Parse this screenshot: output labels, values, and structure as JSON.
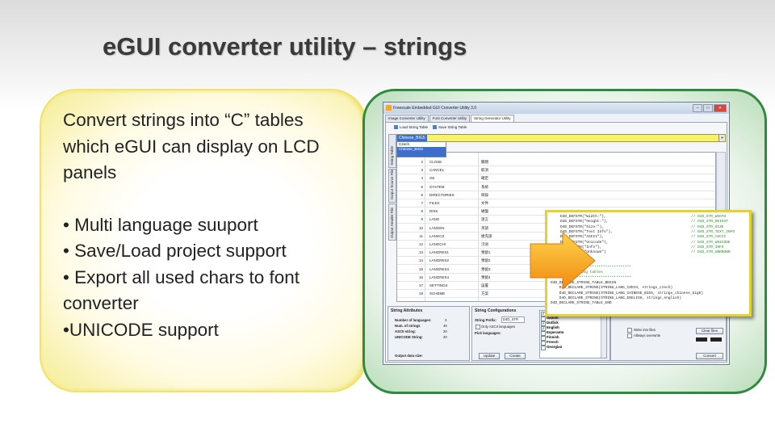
{
  "slide": {
    "title": "eGUI converter utility – strings",
    "intro": "Convert strings into “C” tables which eGUI can display on LCD panels",
    "bullets": [
      "• Multi language suuport",
      "• Save/Load project support",
      "• Export all used chars to font",
      "converter",
      "•UNICODE support"
    ]
  },
  "app": {
    "window_title": "Freescale Embedded GUI Converter Utility 3.0",
    "tabs": [
      "Image Converter Utility",
      "Font Converter Utility",
      "String Generator Utility"
    ],
    "toolbar": {
      "load": "Load String Table",
      "save": "Save String Table"
    },
    "vertical_tabs": [
      "String Table",
      "Output Source File",
      "Output Header File"
    ],
    "language_combo": "Chinese_BIG5",
    "language_dropdown": [
      "Czech",
      "Chinese_BIG5",
      ""
    ],
    "rows": [
      {
        "idx": "2",
        "name": "CLOSE",
        "val": "關閉"
      },
      {
        "idx": "3",
        "name": "CANCEL",
        "val": "取消"
      },
      {
        "idx": "4",
        "name": "OK",
        "val": "確定"
      },
      {
        "idx": "5",
        "name": "SYSTEM",
        "val": "系統"
      },
      {
        "idx": "6",
        "name": "DIRECTORIES",
        "val": "目錄"
      },
      {
        "idx": "7",
        "name": "FILES",
        "val": "文件"
      },
      {
        "idx": "8",
        "name": "DISK",
        "val": "磁盤"
      },
      {
        "idx": "9",
        "name": "LANG",
        "val": "語言"
      },
      {
        "idx": "10",
        "name": "LANGEN",
        "val": "英語"
      },
      {
        "idx": "11",
        "name": "LANGCZ",
        "val": "捷克語"
      },
      {
        "idx": "12",
        "name": "LANGCHI",
        "val": "汉语"
      },
      {
        "idx": "13",
        "name": "LANGRES1",
        "val": "預留1"
      },
      {
        "idx": "14",
        "name": "LANGRES2",
        "val": "預留2"
      },
      {
        "idx": "15",
        "name": "LANGRES3",
        "val": "預留3"
      },
      {
        "idx": "16",
        "name": "LANGRES4",
        "val": "預留4"
      },
      {
        "idx": "17",
        "name": "SETTINGS",
        "val": "設置"
      },
      {
        "idx": "18",
        "name": "SCHEME",
        "val": "方案"
      }
    ],
    "string_attributes": {
      "title": "String Attributes",
      "num_languages_label": "Number of languages:",
      "num_languages": "3",
      "num_strings_label": "Num. of strings",
      "num_strings": "40",
      "ascii_label": "ASCII string:",
      "ascii": "20",
      "unicode_label": "UNICODE String:",
      "unicode": "20",
      "output_size_label": "Output data size:"
    },
    "string_config": {
      "title": "String Configurations",
      "prefix_label": "String Prefix:",
      "prefix": "D4D_STR",
      "only_ascii": "Only ASCII languages",
      "pick_label": "Pick languages:",
      "update": "Update",
      "create": "Create"
    },
    "languages": [
      {
        "name": "Chinese_BIG5",
        "checked": true
      },
      {
        "name": "Danish",
        "checked": false
      },
      {
        "name": "Dutlick",
        "checked": true
      },
      {
        "name": "English",
        "checked": true
      },
      {
        "name": "Esperanto",
        "checked": false
      },
      {
        "name": "Finnish",
        "checked": false
      },
      {
        "name": "French",
        "checked": false
      },
      {
        "name": "Georgian",
        "checked": false
      }
    ],
    "right_group": {
      "write_files": "Write into files",
      "overwrite": "Allways overwrite",
      "clear_files": "Clear files",
      "convert": "Convert"
    }
  },
  "code": {
    "lines": [
      {
        "text": "D4D_DEFSTR(\"Width:\"),",
        "comment": "// D4D_STR_WIDTH"
      },
      {
        "text": "D4D_DEFSTR(\"Height:\"),",
        "comment": "// D4D_STR_HEIGHT"
      },
      {
        "text": "D4D_DEFSTR(\"Size:\"),",
        "comment": "// D4D_STR_SIZE"
      },
      {
        "text": "D4D_DEFSTR(\"Text Info\"),",
        "comment": "// D4D_STR_TEXT_INFO"
      },
      {
        "text": "D4D_DEFSTR(\"ASCII\"),",
        "comment": "// D4D_STR_ASCII"
      },
      {
        "text": "D4D_DEFSTR(\"Unicode\"),",
        "comment": "// D4D_STR_UNICODE"
      },
      {
        "text": "D4D_DEFSTR(\"Info\"),",
        "comment": "// D4D_STR_INFO"
      },
      {
        "text": "D4D_DEFSTR(\"Unknown\")",
        "comment": "// D4D_STR_UNKNOWN"
      }
    ],
    "stars1": "*************************************",
    "stars_comment": "* Table of string tables",
    "stars2": "*************************************",
    "tail": [
      "D4D_DECLARE_STRING_TABLE_BEGIN",
      "    D4D_DECLARE_STRING(STRING_LANG_CZECH, strings_czech)",
      "    D4D_DECLARE_STRING(STRING_LANG_CHINESE_BIG5, strings_chinese_big5)",
      "    D4D_DECLARE_STRING(STRING_LANG_ENGLISH, strings_english)",
      "D4D_DECLARE_STRING_TABLE_END"
    ]
  },
  "colors": {
    "title": "#3a3a3a",
    "highlight": "#f7f26a",
    "selection": "#3d6fc9",
    "arrow": "#f5a21a",
    "border_green": "#2f8a3f"
  }
}
